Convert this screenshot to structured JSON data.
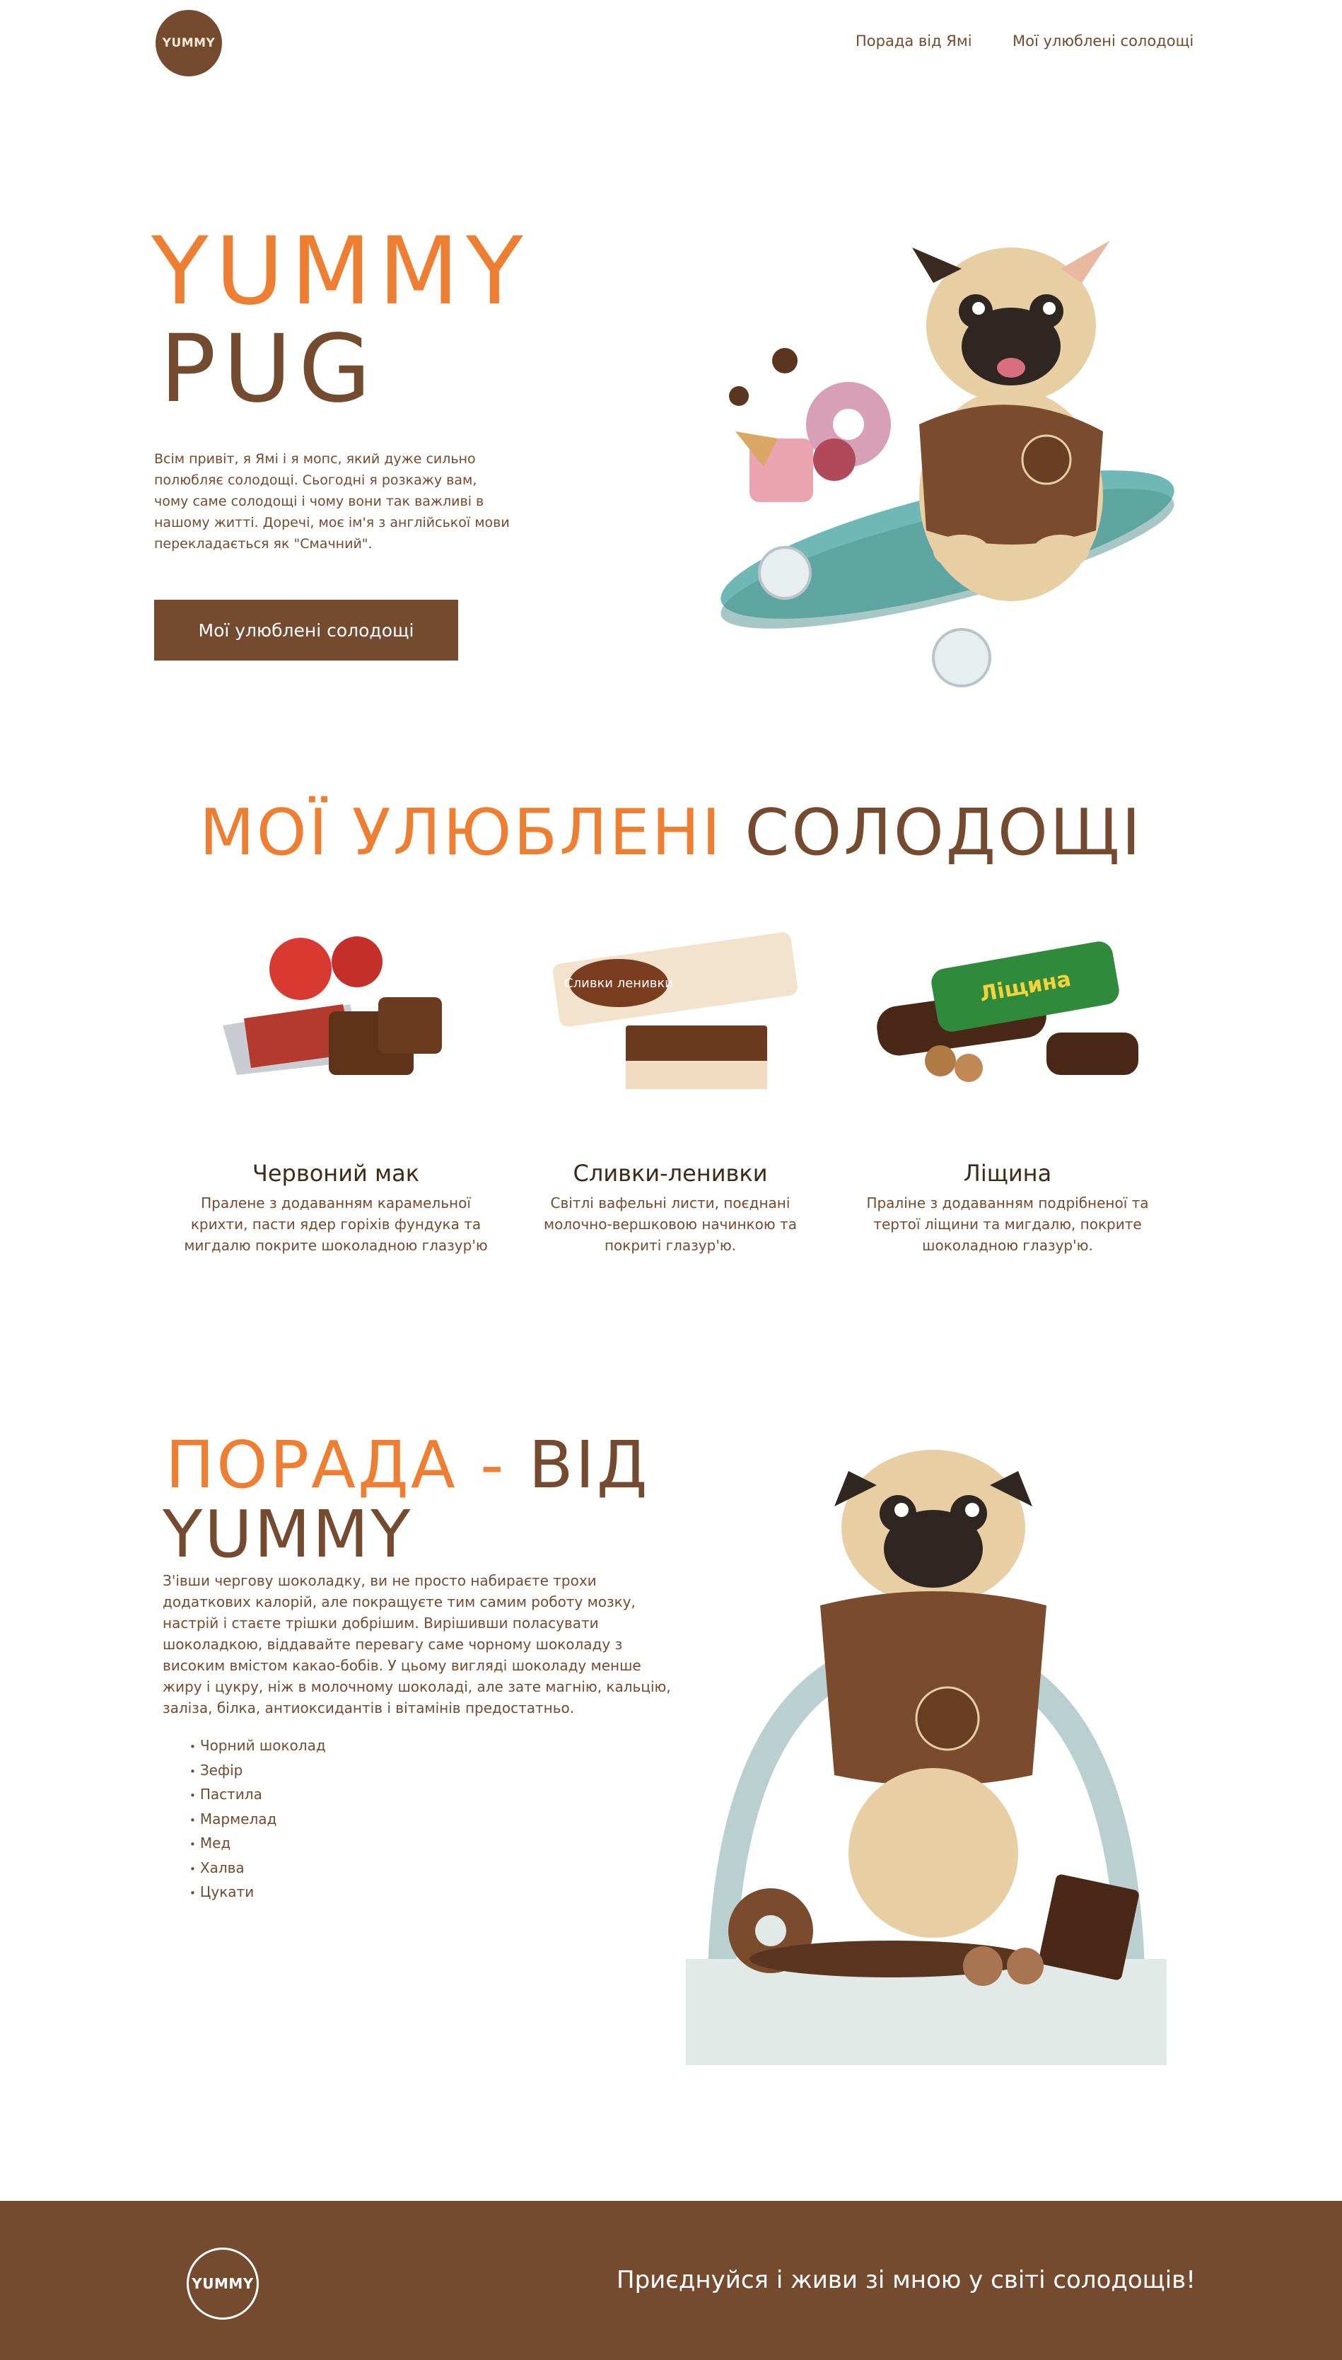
{
  "header": {
    "logo_text": "YUMMY",
    "nav": [
      {
        "label": "Порада від Ямі"
      },
      {
        "label": "Мої улюблені солодощі"
      }
    ]
  },
  "hero": {
    "title_line1": "YUMMY",
    "title_line2": "PUG",
    "description": "Всім привіт, я Ямі і я мопс, який дуже сильно полюбляє солодощі. Сьогодні я розкажу вам, чому саме солодощі і чому вони так важливі в нашому житті. Доречі, моє ім'я з англійської мови перекладається як \"Смачний\".",
    "cta_label": "Мої улюблені солодощі"
  },
  "favorites": {
    "title_orange": "МОЇ УЛЮБЛЕНІ",
    "title_brown": "СОЛОДОЩІ",
    "items": [
      {
        "name": "Червоний мак",
        "description": "Пралене з додаванням карамельної крихти, пасти ядер горіхів фундука та мигдалю покрите шоколадною глазур'ю",
        "wrapper_label": ""
      },
      {
        "name": "Сливки-ленивки",
        "description": "Світлі вафельні листи, поєднані молочно-вершковою начинкою та покриті глазур'ю.",
        "wrapper_label": "Сливки ленивки"
      },
      {
        "name": "Ліщина",
        "description": "Праліне з додаванням подрібненої та тертої ліщини та мигдалю, покрите шоколадною глазур'ю.",
        "wrapper_label": "Ліщина"
      }
    ]
  },
  "tip": {
    "title_orange": "ПОРАДА -",
    "title_brown_1": "ВІД",
    "title_brown_2": "YUMMY",
    "description": "З'івши чергову шоколадку, ви не просто набираєте трохи додаткових калорій, але покращуєте тим самим роботу мозку, настрій і стаєте трішки добрішим. Вирішивши поласувати шоколадкою, віддавайте перевагу саме чорному шоколаду з високим вмістом какао-бобів. У цьому вигляді шоколаду менше жиру і цукру, ніж в молочному шоколаді, але зате магнію, кальцію, заліза, білка, антиоксидантів і вітамінів предостатньо.",
    "list": [
      "Чорний шоколад",
      "Зефір",
      "Пастила",
      "Мармелад",
      "Мед",
      "Халва",
      "Цукати"
    ]
  },
  "footer": {
    "logo_text": "YUMMY",
    "slogan": "Приєднуйся і живи зі мною у світі солодощів!"
  },
  "colors": {
    "brand_brown": "#744b2e",
    "accent_orange": "#ee7f32",
    "skateboard": "#6fb8b5"
  }
}
